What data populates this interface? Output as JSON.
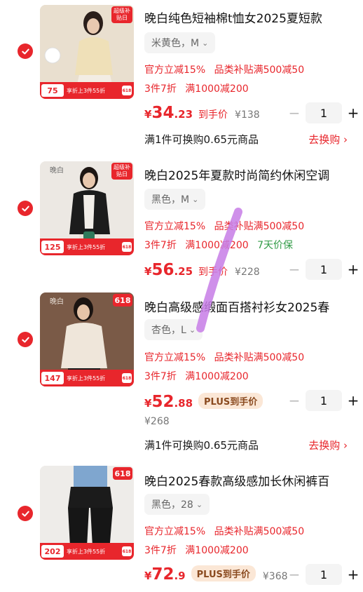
{
  "colors": {
    "accent": "#e8262c",
    "green": "#2f9a44",
    "plus_badge_bg": "#fbe7d6"
  },
  "items": [
    {
      "title": "晚白纯色短袖棉t恤女2025夏短款",
      "spec": "米黄色，M",
      "promo1": [
        "官方立减15%",
        "品类补贴满500减50"
      ],
      "promo2": [
        "3件7折",
        "满1000减200"
      ],
      "price_int": "34",
      "price_dec": ".23",
      "price_label": "到手价",
      "orig_price": "¥138",
      "qty": "1",
      "exchange_text": "满1件可换购0.65元商品",
      "exchange_link": "去换购 ›",
      "thumb": {
        "price": "75",
        "promo": "享折上3件55折",
        "tag": "超级补贴日"
      }
    },
    {
      "title": "晚白2025年夏款时尚简约休闲空调",
      "spec": "黑色，M",
      "promo1": [
        "官方立减15%",
        "品类补贴满500减50"
      ],
      "promo2": [
        "3件7折",
        "满1000减200",
        "7天价保"
      ],
      "price_int": "56",
      "price_dec": ".25",
      "price_label": "到手价",
      "orig_price": "¥228",
      "qty": "1",
      "thumb": {
        "price": "125",
        "promo": "享折上3件55折",
        "tag": "超级补贴日",
        "brand": "晚白"
      }
    },
    {
      "title": "晚白高级感缎面百搭衬衫女2025春",
      "spec": "杏色，L",
      "promo1": [
        "官方立减15%",
        "品类补贴满500减50"
      ],
      "promo2": [
        "3件7折",
        "满1000减200"
      ],
      "price_int": "52",
      "price_dec": ".88",
      "price_label": "PLUS到手价",
      "orig_price": "¥268",
      "qty": "1",
      "exchange_text": "满1件可换购0.65元商品",
      "exchange_link": "去换购 ›",
      "thumb": {
        "price": "147",
        "promo": "享折上3件55折",
        "tag": "618",
        "brand": "晚白"
      }
    },
    {
      "title": "晚白2025春款高级感加长休闲裤百",
      "spec": "黑色，28",
      "promo1": [
        "官方立减15%",
        "品类补贴满500减50"
      ],
      "promo2": [
        "3件7折",
        "满1000减200"
      ],
      "price_int": "72",
      "price_dec": ".9",
      "price_label": "PLUS到手价",
      "orig_price": "¥368",
      "qty": "1",
      "thumb": {
        "price": "202",
        "promo": "享折上3件55折",
        "tag": "618"
      }
    }
  ],
  "ui": {
    "yen": "¥",
    "minus": "−",
    "plus": "+",
    "chevron": "⌄"
  }
}
